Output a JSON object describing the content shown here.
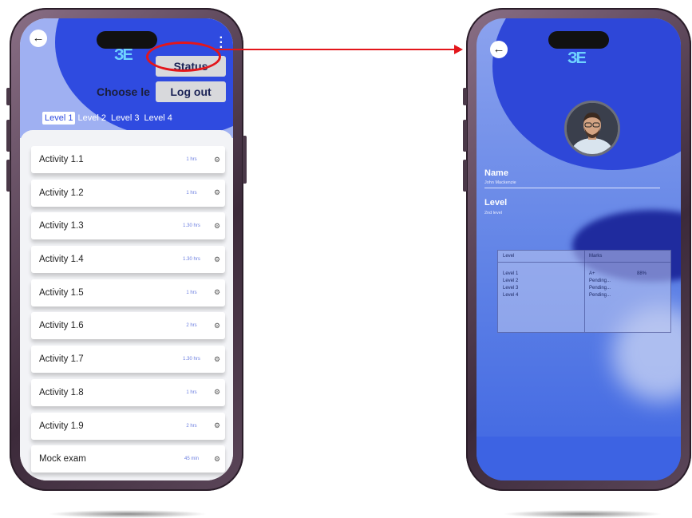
{
  "left_phone": {
    "logo": "ЗЕ",
    "header": {
      "title": "Choose le",
      "back_icon": "arrow-left-icon"
    },
    "menu": [
      {
        "label": "Status"
      },
      {
        "label": "Log out"
      }
    ],
    "tabs": [
      {
        "label": "Level 1",
        "active": true
      },
      {
        "label": "Level 2",
        "active": false
      },
      {
        "label": "Level 3",
        "active": false
      },
      {
        "label": "Level 4",
        "active": false
      }
    ],
    "activities": [
      {
        "title": "Activity 1.1",
        "duration": "1 hrs"
      },
      {
        "title": "Activity 1.2",
        "duration": "1 hrs"
      },
      {
        "title": "Activity 1.3",
        "duration": "1.30 hrs"
      },
      {
        "title": "Activity 1.4",
        "duration": "1.30 hrs"
      },
      {
        "title": "Activity 1.5",
        "duration": "1 hrs"
      },
      {
        "title": "Activity 1.6",
        "duration": "2 hrs"
      },
      {
        "title": "Activity 1.7",
        "duration": "1.30 hrs"
      },
      {
        "title": "Activity 1.8",
        "duration": "1 hrs"
      },
      {
        "title": "Activity 1.9",
        "duration": "2 hrs"
      },
      {
        "title": "Mock exam",
        "duration": "45 min"
      }
    ]
  },
  "right_phone": {
    "logo": "ЗЕ",
    "back_icon": "arrow-left-icon",
    "profile": {
      "name_label": "Name",
      "name_value": "John Mackenzie",
      "level_label": "Level",
      "level_value": "2nd level"
    },
    "status_table": {
      "headers": [
        "Level",
        "Marks"
      ],
      "rows": [
        {
          "level": "Level 1",
          "mark": "A+",
          "percent": "88%"
        },
        {
          "level": "Level 2",
          "mark": "Pending...",
          "percent": ""
        },
        {
          "level": "Level 3",
          "mark": "Pending...",
          "percent": ""
        },
        {
          "level": "Level 4",
          "mark": "Pending...",
          "percent": ""
        }
      ]
    }
  },
  "colors": {
    "primary_blue": "#2f4be0",
    "annotation_red": "#e3161b"
  }
}
